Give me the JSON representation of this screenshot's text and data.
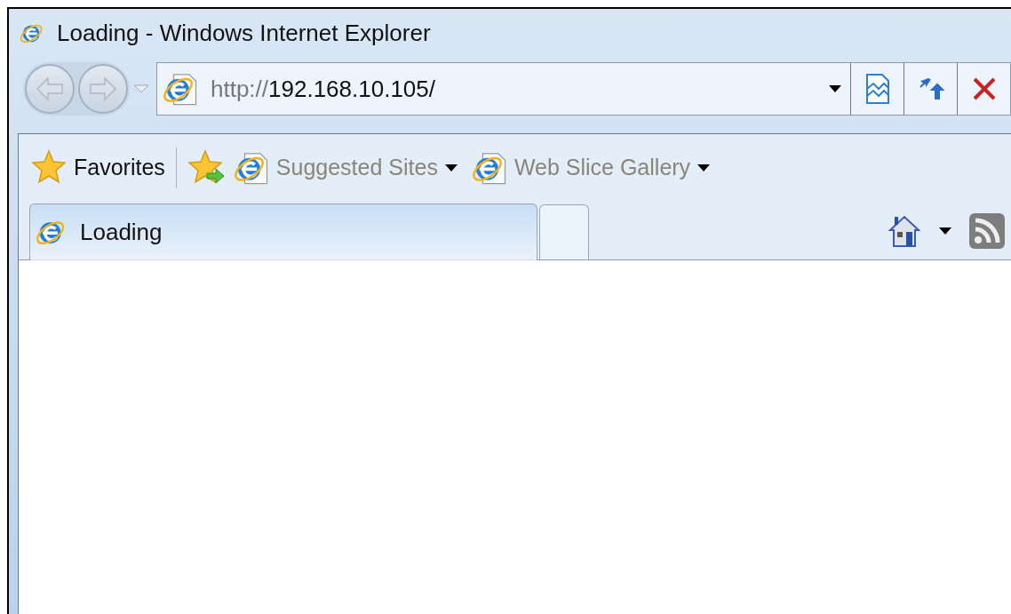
{
  "window": {
    "title": "Loading - Windows Internet Explorer"
  },
  "navigation": {
    "back": {
      "disabled": true
    },
    "forward": {
      "disabled": true
    }
  },
  "address": {
    "scheme": "http://",
    "host": "192.168.10.105/"
  },
  "favorites_bar": {
    "favorites": "Favorites",
    "items": [
      {
        "label": "Suggested Sites"
      },
      {
        "label": "Web Slice Gallery"
      }
    ]
  },
  "tabs": [
    {
      "label": "Loading",
      "selected": true
    }
  ]
}
